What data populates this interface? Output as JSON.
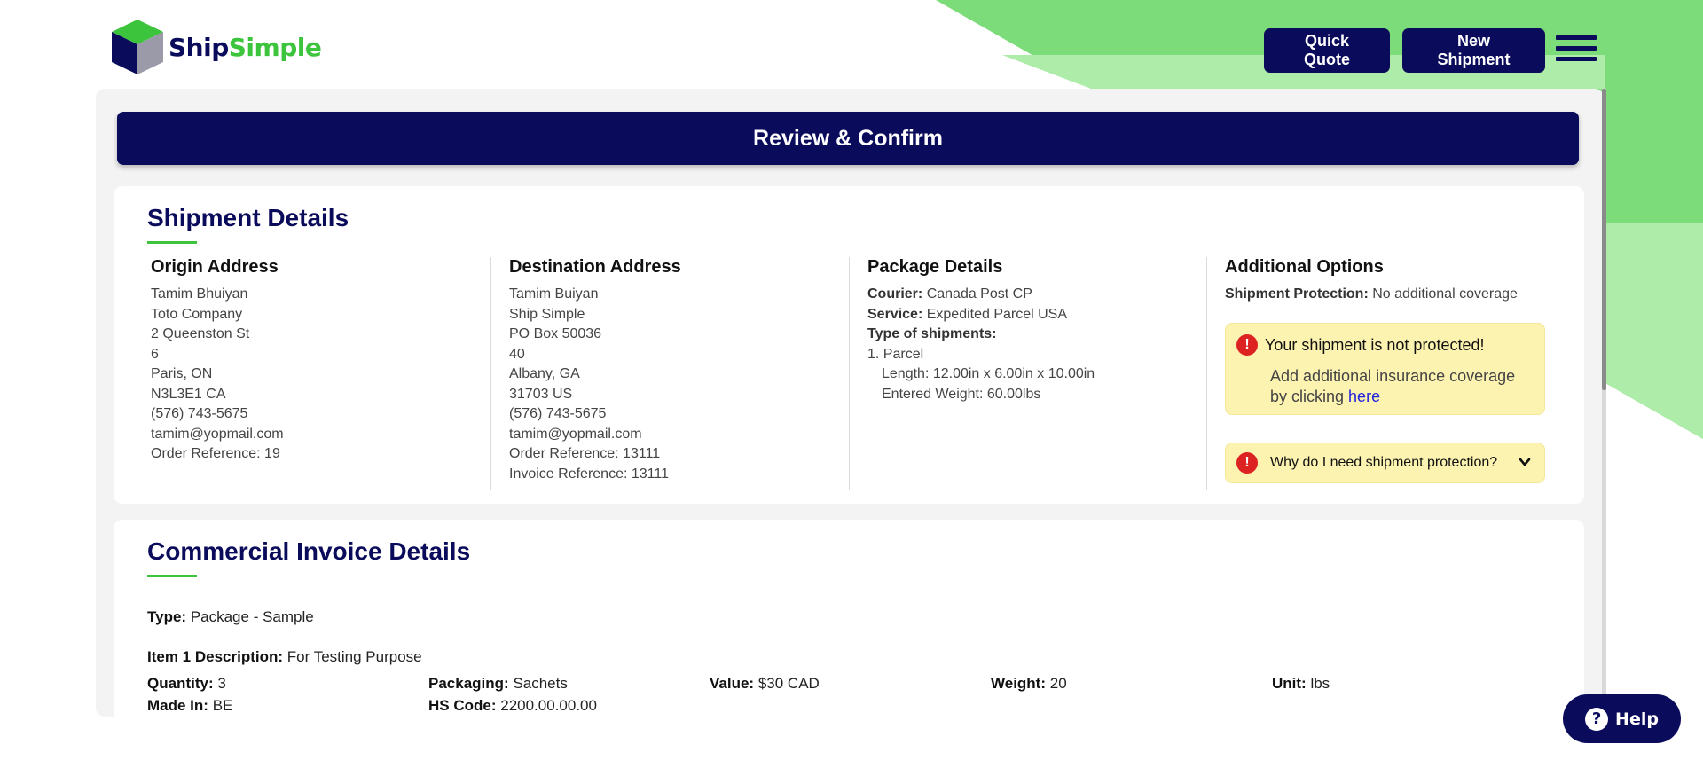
{
  "header": {
    "logo_ship": "Ship",
    "logo_simple": "Simple",
    "quick_quote_label": "Quick Quote",
    "new_shipment_label": "New Shipment"
  },
  "review_title": "Review & Confirm",
  "shipment_details": {
    "title": "Shipment Details",
    "origin": {
      "heading": "Origin Address",
      "lines": [
        "Tamim Bhuiyan",
        "Toto Company",
        "2 Queenston St",
        "6",
        "Paris, ON",
        "N3L3E1 CA",
        "(576) 743-5675",
        "tamim@yopmail.com",
        "Order Reference: 19"
      ]
    },
    "destination": {
      "heading": "Destination Address",
      "lines": [
        "Tamim Buiyan",
        "Ship Simple",
        "PO Box 50036",
        "40",
        "Albany, GA",
        "31703 US",
        "(576) 743-5675",
        "tamim@yopmail.com",
        "Order Reference: 13111",
        "Invoice Reference: 13111"
      ]
    },
    "package": {
      "heading": "Package Details",
      "courier_label": "Courier:",
      "courier_value": "Canada Post CP",
      "service_label": "Service:",
      "service_value": "Expedited Parcel USA",
      "type_label": "Type of shipments:",
      "parcel": "1. Parcel",
      "length": "Length: 12.00in x 6.00in x 10.00in",
      "weight": "Entered Weight: 60.00lbs"
    },
    "additional": {
      "heading": "Additional Options",
      "protection_label": "Shipment Protection:",
      "protection_value": "No additional coverage",
      "alert_title": "Your shipment is not protected!",
      "alert_body": "Add additional insurance coverage by clicking",
      "alert_link": "here",
      "faq_label": "Why do I need shipment protection?"
    }
  },
  "invoice": {
    "title": "Commercial Invoice Details",
    "type_label": "Type:",
    "type_value": "Package - Sample",
    "item_desc_label": "Item 1 Description:",
    "item_desc_value": "For Testing Purpose",
    "quantity_label": "Quantity:",
    "quantity_value": "3",
    "packaging_label": "Packaging:",
    "packaging_value": "Sachets",
    "value_label": "Value:",
    "value_value": "$30 CAD",
    "weight_label": "Weight:",
    "weight_value": "20",
    "unit_label": "Unit:",
    "unit_value": "lbs",
    "made_in_label": "Made In:",
    "made_in_value": "BE",
    "hs_code_label": "HS Code:",
    "hs_code_value": "2200.00.00.00"
  },
  "help_label": "Help",
  "icons": [
    "cube-logo-icon",
    "hamburger-menu-icon",
    "alert-icon",
    "chevron-down-icon",
    "help-question-icon"
  ],
  "colors": {
    "navy": "#0b0b5c",
    "green": "#3cc43c",
    "alert_bg": "#fdf3b0",
    "alert_red": "#dd2222"
  }
}
